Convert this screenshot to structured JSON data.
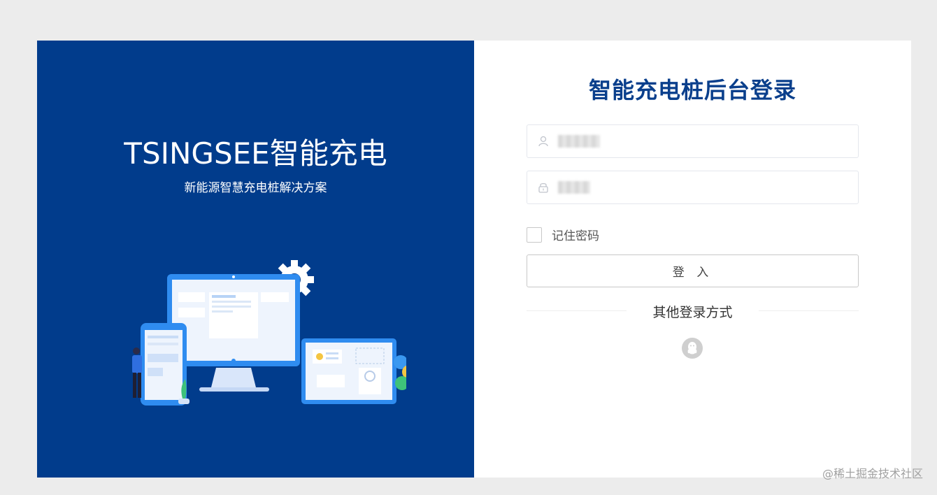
{
  "brand": {
    "title": "TSINGSEE智能充电",
    "subtitle": "新能源智慧充电桩解决方案"
  },
  "login": {
    "title": "智能充电桩后台登录",
    "username_placeholder": "",
    "password_placeholder": "",
    "remember_label": "记住密码",
    "submit_label": "登 入",
    "other_methods_label": "其他登录方式"
  },
  "watermark": "@稀土掘金技术社区",
  "colors": {
    "brand_blue": "#013c8c",
    "title_blue": "#0a3f8c",
    "page_bg": "#ececec"
  },
  "icons": {
    "username": "user-icon",
    "password": "lock-icon",
    "social": "qq-icon"
  }
}
